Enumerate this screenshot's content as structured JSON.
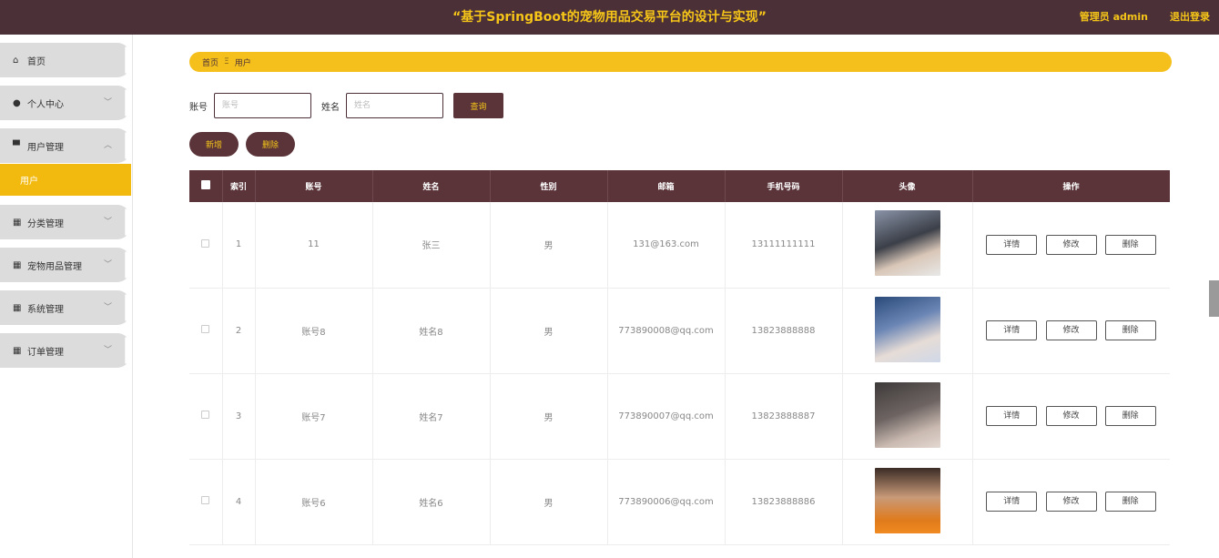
{
  "header": {
    "title": "“基于SpringBoot的宠物用品交易平台的设计与实现”",
    "user_label": "管理员 admin",
    "logout_label": "退出登录"
  },
  "sidebar": {
    "items": [
      {
        "label": "首页",
        "icon": "home-icon"
      },
      {
        "label": "个人中心",
        "icon": "user-icon"
      },
      {
        "label": "用户管理",
        "icon": "users-manage-icon"
      },
      {
        "label": "分类管理",
        "icon": "grid-icon"
      },
      {
        "label": "宠物用品管理",
        "icon": "grid-icon"
      },
      {
        "label": "系统管理",
        "icon": "grid-icon"
      },
      {
        "label": "订单管理",
        "icon": "grid-icon"
      }
    ],
    "active_sub": "用户"
  },
  "breadcrumb": {
    "home": "首页",
    "sep": "Ξ",
    "current": "用户"
  },
  "search": {
    "account_label": "账号",
    "account_placeholder": "账号",
    "name_label": "姓名",
    "name_placeholder": "姓名",
    "query_label": "查询"
  },
  "actions": {
    "add_label": "新增",
    "delete_label": "删除"
  },
  "table": {
    "headers": [
      "索引",
      "账号",
      "姓名",
      "性别",
      "邮箱",
      "手机号码",
      "头像",
      "操作"
    ],
    "rows": [
      {
        "index": "1",
        "account": "11",
        "name": "张三",
        "gender": "男",
        "email": "131@163.com",
        "phone": "13111111111"
      },
      {
        "index": "2",
        "account": "账号8",
        "name": "姓名8",
        "gender": "男",
        "email": "773890008@qq.com",
        "phone": "13823888888"
      },
      {
        "index": "3",
        "account": "账号7",
        "name": "姓名7",
        "gender": "男",
        "email": "773890007@qq.com",
        "phone": "13823888887"
      },
      {
        "index": "4",
        "account": "账号6",
        "name": "姓名6",
        "gender": "男",
        "email": "773890006@qq.com",
        "phone": "13823888886"
      }
    ],
    "op_labels": {
      "detail": "详情",
      "edit": "修改",
      "delete": "删除"
    }
  },
  "colors": {
    "brand_dark": "#4c3038",
    "accent_yellow": "#f5c01c",
    "active_menu": "#f2b90f"
  }
}
